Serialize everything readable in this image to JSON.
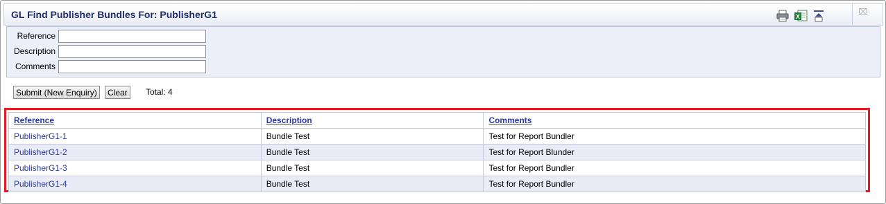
{
  "window": {
    "title": "GL Find Publisher Bundles For: PublisherG1",
    "toolbar_icons": [
      "print-icon",
      "excel-export-icon",
      "collapse-icon"
    ],
    "close_label": "⌧"
  },
  "form": {
    "fields": [
      {
        "label": "Reference",
        "value": ""
      },
      {
        "label": "Description",
        "value": ""
      },
      {
        "label": "Comments",
        "value": ""
      }
    ]
  },
  "actions": {
    "submit_label": "Submit (New Enquiry)",
    "clear_label": "Clear",
    "total_text": "Total: 4"
  },
  "grid": {
    "columns": [
      "Reference",
      "Description",
      "Comments"
    ],
    "rows": [
      {
        "reference": "PublisherG1-1",
        "description": "Bundle Test",
        "comments": "Test for Report Bundler"
      },
      {
        "reference": "PublisherG1-2",
        "description": "Bundle Test",
        "comments": "Test for Report Blunder"
      },
      {
        "reference": "PublisherG1-3",
        "description": "Bundle Test",
        "comments": "Test for Report Bundler"
      },
      {
        "reference": "PublisherG1-4",
        "description": "Bundle Test",
        "comments": "Test for Report Bundler"
      }
    ],
    "highlight_color": "#e21c23"
  }
}
